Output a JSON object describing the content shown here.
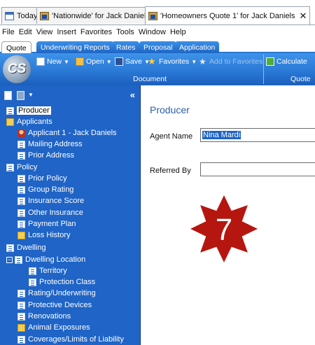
{
  "doc_tabs": [
    {
      "label": "Today"
    },
    {
      "label": "'Nationwide' for Jack Daniels"
    },
    {
      "label": "'Homeowners Quote 1' for Jack Daniels"
    }
  ],
  "doc_tab_close": "✕",
  "menu": [
    "File",
    "Edit",
    "View",
    "Insert",
    "Favorites",
    "Tools",
    "Window",
    "Help"
  ],
  "ribbon_tabs": [
    "Quote",
    "Underwriting Reports",
    "Rates",
    "Proposal",
    "Application"
  ],
  "logo_text": "CS",
  "ribbon": {
    "new": "New",
    "open": "Open",
    "save": "Save",
    "favorites": "Favorites",
    "add_to_favorites": "Add to Favorites",
    "calculate": "Calculate",
    "group_document": "Document",
    "group_quote": "Quote"
  },
  "sidebar": {
    "collapse_glyph": "«",
    "items": [
      {
        "label": "Producer"
      },
      {
        "label": "Applicants"
      },
      {
        "label": "Applicant 1 - Jack Daniels"
      },
      {
        "label": "Mailing Address"
      },
      {
        "label": "Prior Address"
      },
      {
        "label": "Policy"
      },
      {
        "label": "Prior Policy"
      },
      {
        "label": "Group Rating"
      },
      {
        "label": "Insurance Score"
      },
      {
        "label": "Other Insurance"
      },
      {
        "label": "Payment Plan"
      },
      {
        "label": "Loss History"
      },
      {
        "label": "Dwelling"
      },
      {
        "label": "Dwelling Location"
      },
      {
        "label": "Territory"
      },
      {
        "label": "Protection Class"
      },
      {
        "label": "Rating/Underwriting"
      },
      {
        "label": "Protective Devices"
      },
      {
        "label": "Renovations"
      },
      {
        "label": "Animal Exposures"
      },
      {
        "label": "Coverages/Limits of Liability"
      }
    ],
    "expander_glyph": "−"
  },
  "main": {
    "title": "Producer",
    "agent_name_label": "Agent Name",
    "agent_name_value": "Nina Mardi",
    "referred_by_label": "Referred By",
    "referred_by_value": ""
  },
  "badge": {
    "number": "7",
    "color": "#b5160f"
  }
}
